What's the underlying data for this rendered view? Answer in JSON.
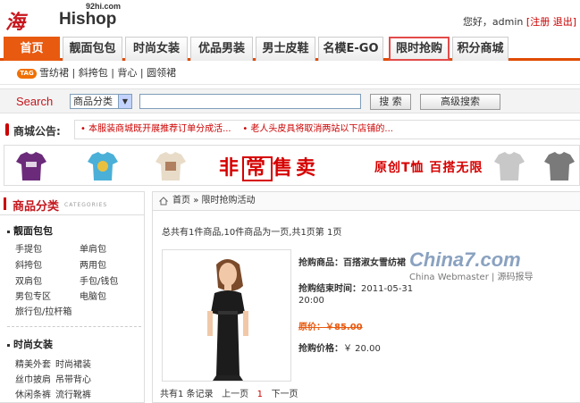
{
  "logo": {
    "cn": "海商",
    "en": "Hishop",
    "domain": "92hi.com"
  },
  "userbar": {
    "greeting": "您好，admin",
    "register": "[注册",
    "logout": "退出]"
  },
  "nav": {
    "tabs": [
      {
        "label": "首页"
      },
      {
        "label": "靓面包包"
      },
      {
        "label": "时尚女装"
      },
      {
        "label": "优品男装"
      },
      {
        "label": "男士皮鞋"
      },
      {
        "label": "名模E-GO"
      },
      {
        "label": "限时抢购"
      },
      {
        "label": "积分商城"
      }
    ]
  },
  "subnav": {
    "tag": "TAG",
    "links": [
      "雪纺裙",
      "斜挎包",
      "背心",
      "圆领裙"
    ]
  },
  "search": {
    "label": "Search",
    "category": "商品分类",
    "search_btn": "搜 索",
    "adv_btn": "高级搜索",
    "value": ""
  },
  "notice": {
    "label": "商城公告:",
    "items": [
      "• 本服装商城既开展推荐订单分成活...",
      "• 老人头皮具将取消两站以下店铺的..."
    ]
  },
  "banner": {
    "pre": "非",
    "box": "常",
    "post": "售卖",
    "sub": "原创T恤  百搭无限"
  },
  "sidebar": {
    "title": "商品分类",
    "subtitle": "CATEGORIES",
    "groups": [
      {
        "title": "靓面包包",
        "items": [
          "手提包",
          "单肩包",
          "斜挎包",
          "两用包",
          "双肩包",
          "手包/钱包",
          "男包专区",
          "电脑包",
          "旅行包/拉杆箱"
        ]
      },
      {
        "title": "时尚女装",
        "items": [
          "精美外套",
          "时尚裙装",
          "丝巾披肩",
          "吊带背心",
          "休闲条裤",
          "流行靴裤"
        ]
      }
    ]
  },
  "breadcrumb": {
    "home": "首页",
    "sep": "»",
    "current": "限时抢购活动"
  },
  "summary": "总共有1件商品,10件商品为一页,共1页第  1页",
  "product": {
    "name_label": "抢购商品：",
    "name": "百搭淑女雪纺裙",
    "end_label": "抢购结束时间：",
    "end_date": "2011-05-31",
    "end_time": "20:00",
    "orig_label": "原价：",
    "orig_price": "￥85.00",
    "price_label": "抢购价格：",
    "price": "￥ 20.00"
  },
  "pager": {
    "total": "共有1 条记录",
    "prev": "上一页",
    "page": "1",
    "next": "下一页"
  },
  "watermark": {
    "big": "China7.com",
    "small": "China Webmaster | 源码报导"
  },
  "colors": {
    "brand_red": "#c4161c",
    "nav_orange": "#e85a10"
  }
}
